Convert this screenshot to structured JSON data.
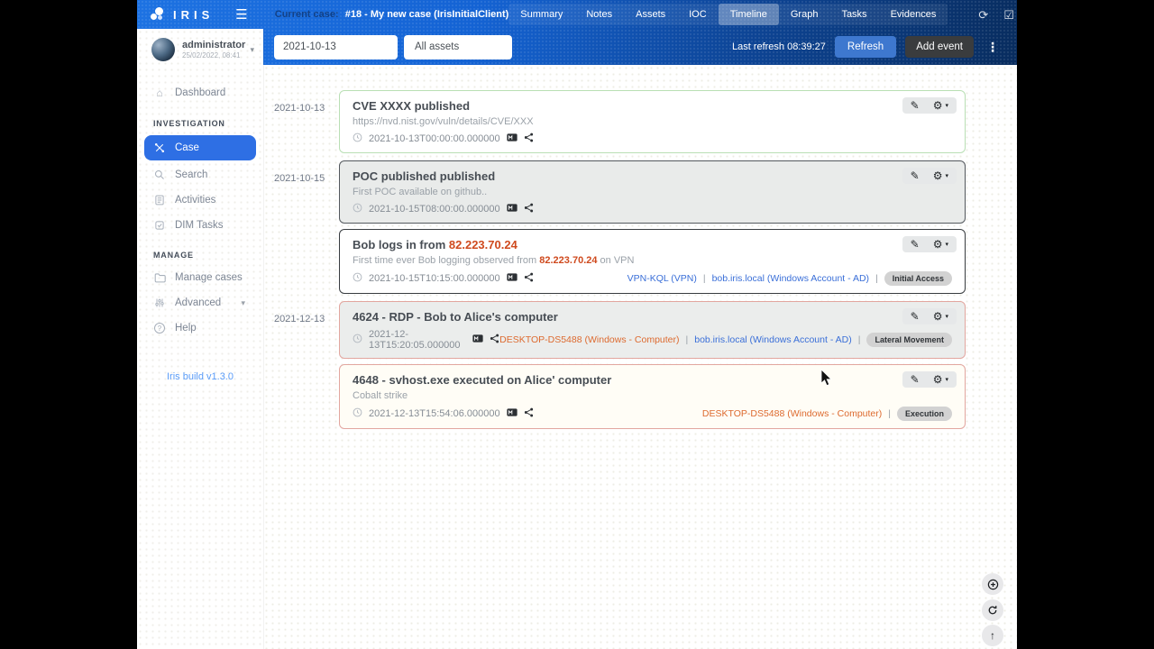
{
  "navbar": {
    "brand": "IRIS",
    "current_case_label": "Current case:",
    "current_case_title": "#18 - My new case (IrisInitialClient)",
    "tabs": [
      {
        "label": "Summary",
        "active": false
      },
      {
        "label": "Notes",
        "active": false
      },
      {
        "label": "Assets",
        "active": false
      },
      {
        "label": "IOC",
        "active": false
      },
      {
        "label": "Timeline",
        "active": true
      },
      {
        "label": "Graph",
        "active": false
      },
      {
        "label": "Tasks",
        "active": false
      },
      {
        "label": "Evidences",
        "active": false
      }
    ],
    "icons": [
      "sync-icon",
      "check-square-icon",
      "apps-grid-icon"
    ]
  },
  "filter_bar": {
    "date_filter_value": "2021-10-13",
    "asset_filter_value": "All assets",
    "last_refresh": "Last refresh 08:39:27",
    "refresh_button": "Refresh",
    "add_event_button": "Add event"
  },
  "sidebar": {
    "user": {
      "name": "administrator",
      "last_login": "25/02/2022, 08:41"
    },
    "dashboard_label": "Dashboard",
    "sections": [
      {
        "title": "INVESTIGATION",
        "items": [
          "Case",
          "Search",
          "Activities",
          "DIM Tasks"
        ]
      },
      {
        "title": "MANAGE",
        "items": [
          "Manage cases",
          "Advanced",
          "Help"
        ]
      }
    ],
    "active_item": "Case",
    "build_version": "Iris build v1.3.0"
  },
  "timeline": {
    "groups": [
      {
        "date": "2021-10-13",
        "events": [
          {
            "title": [
              {
                "t": "CVE XXXX published"
              }
            ],
            "description": [
              {
                "t": "https://nvd.nist.gov/vuln/details/CVE/XXX"
              }
            ],
            "timestamp": "2021-10-13T00:00:00.000000",
            "border": "#b9dfb4",
            "bg": "#ffffff",
            "links": [],
            "badge": null
          }
        ]
      },
      {
        "date": "2021-10-15",
        "events": [
          {
            "title": [
              {
                "t": "POC published published"
              }
            ],
            "description": [
              {
                "t": "First POC available on github.."
              }
            ],
            "timestamp": "2021-10-15T08:00:00.000000",
            "border": "#53585d",
            "bg": "#e9ebea",
            "links": [],
            "badge": null
          },
          {
            "title": [
              {
                "t": "Bob logs in from "
              },
              {
                "t": "82.223.70.24",
                "c": "ioc"
              }
            ],
            "description": [
              {
                "t": "First time ever Bob logging observed from "
              },
              {
                "t": "82.223.70.24",
                "c": "ioc"
              },
              {
                "t": " on VPN"
              }
            ],
            "timestamp": "2021-10-15T10:15:00.000000",
            "border": "#383c40",
            "bg": "#ffffff",
            "links": [
              {
                "text": "VPN-KQL (VPN)",
                "c": "blue"
              },
              {
                "text": "bob.iris.local (Windows Account - AD)",
                "c": "blue"
              }
            ],
            "badge": "Initial Access"
          }
        ]
      },
      {
        "date": "2021-12-13",
        "events": [
          {
            "title": [
              {
                "t": "4624 - RDP - Bob to Alice's computer"
              }
            ],
            "description": null,
            "timestamp": "2021-12-13T15:20:05.000000",
            "border": "#e2a69f",
            "bg": "#ebedec",
            "links": [
              {
                "text": "DESKTOP-DS5488 (Windows - Computer)",
                "c": "orange"
              },
              {
                "text": "bob.iris.local (Windows Account - AD)",
                "c": "blue"
              }
            ],
            "badge": "Lateral Movement"
          },
          {
            "title": [
              {
                "t": "4648 - svhost.exe executed on Alice' computer"
              }
            ],
            "description": [
              {
                "t": "Cobalt strike"
              }
            ],
            "timestamp": "2021-12-13T15:54:06.000000",
            "border": "#e2a69f",
            "bg": "#fffdf6",
            "links": [
              {
                "text": "DESKTOP-DS5488 (Windows - Computer)",
                "c": "orange"
              }
            ],
            "badge": "Execution"
          }
        ]
      }
    ]
  },
  "colors": {
    "ioc_orange": "#cf4a1e",
    "asset_orange": "#dd6a2f",
    "link_blue": "#3a6fd8",
    "navbar_blue": "#1463d4",
    "active_item_blue": "#2e6fe4",
    "badge_bg": "#d2d2d2"
  }
}
